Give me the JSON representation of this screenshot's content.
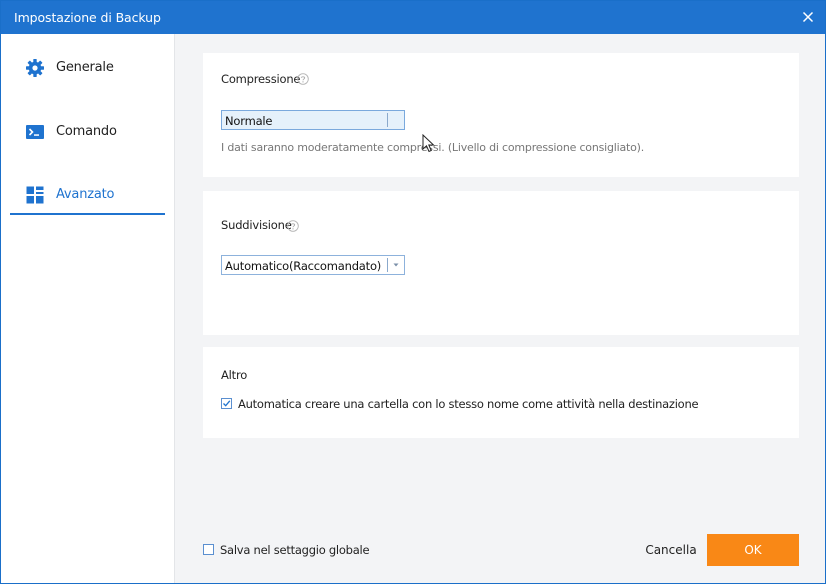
{
  "window": {
    "title": "Impostazione di Backup"
  },
  "sidebar": {
    "items": [
      {
        "label": "Generale",
        "icon": "gear-icon",
        "active": false
      },
      {
        "label": "Comando",
        "icon": "terminal-icon",
        "active": false
      },
      {
        "label": "Avanzato",
        "icon": "grid-icon",
        "active": true
      }
    ]
  },
  "compression": {
    "title": "Compressione",
    "selected": "Normale",
    "description": "I dati saranno moderatamente compressi. (Livello di compressione consigliato)."
  },
  "splitting": {
    "title": "Suddivisione",
    "selected": "Automatico(Raccomandato)"
  },
  "other": {
    "title": "Altro",
    "auto_folder": {
      "label": "Automatica creare una cartella con lo stesso nome come attività nella destinazione",
      "checked": true
    }
  },
  "footer": {
    "save_global": {
      "label": "Salva nel settaggio globale",
      "checked": false
    },
    "cancel_label": "Cancella",
    "ok_label": "OK"
  },
  "colors": {
    "titlebar": "#1f73cf",
    "accent": "#1f73cf",
    "ok_button": "#f98816",
    "background": "#f3f4f6"
  }
}
